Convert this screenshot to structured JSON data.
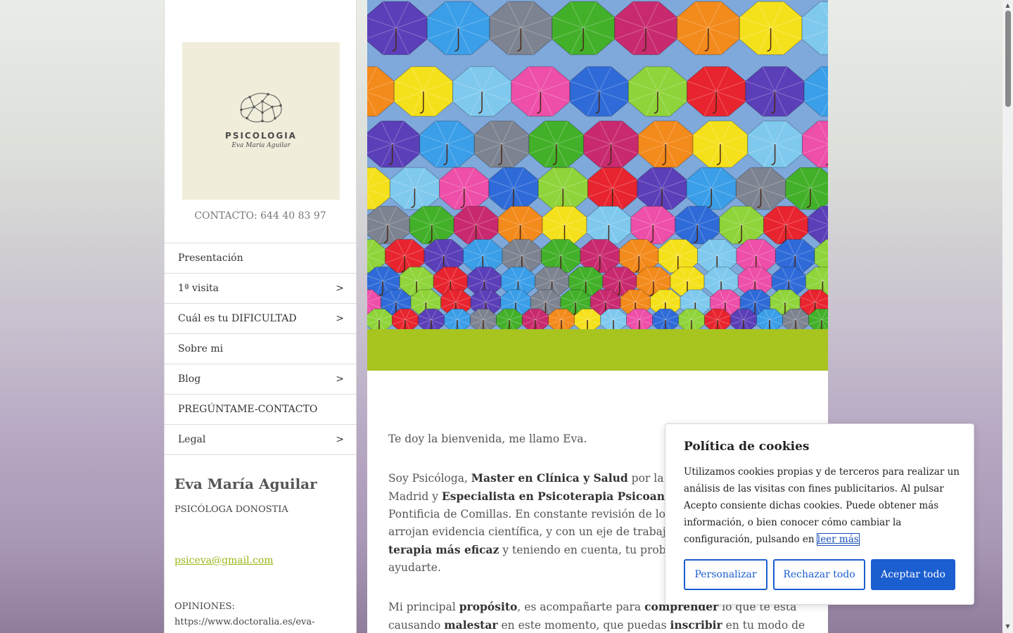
{
  "sidebar": {
    "logo": {
      "word": "PSICOLOGIA",
      "sub": "Eva María Aguilar"
    },
    "contact": "CONTACTO: 644 40 83 97",
    "nav": [
      {
        "label": "Presentación",
        "arrow": ""
      },
      {
        "label": "1ª visita",
        "arrow": ">"
      },
      {
        "label": "Cuál es tu DIFICULTAD",
        "arrow": ">"
      },
      {
        "label": "Sobre mi",
        "arrow": ""
      },
      {
        "label": "Blog",
        "arrow": ">"
      },
      {
        "label": "PREGÚNTAME-CONTACTO",
        "arrow": ""
      },
      {
        "label": "Legal",
        "arrow": ">"
      }
    ],
    "name": "Eva María Aguilar",
    "role": "PSICÓLOGA DONOSTIA",
    "email": "psiceva@gmail.com",
    "opinions_label": "OPINIONES:",
    "opinions_url": "https://www.doctoralia.es/eva-"
  },
  "main": {
    "welcome": "Te doy la bienvenida, me llamo Eva.",
    "p2": {
      "a": "Soy Psicóloga, ",
      "b": "Master en Clínica y Salud",
      "c": " por la Univ",
      "d": "Madrid y ",
      "e": "Especialista en Psicoterapia Psicoanalítica",
      "f": "Pontificia de Comillas. En constante revisión de los ú",
      "g": "arrojan evidencia científica, y con un eje de trabajo s",
      "h": "terapia más eficaz",
      "i": " y teniendo en cuenta, tu problema",
      "j": "ayudarte."
    },
    "p3": {
      "a": "Mi principal ",
      "b": "propósito",
      "c": ", es acompañarte para ",
      "d": "comprender",
      "e": " lo que te está",
      "f": "causando ",
      "g": "malestar",
      "h": " en este momento, que puedas ",
      "i": "inscribir",
      "j": " en tu modo de"
    }
  },
  "cookie": {
    "title": "Política de cookies",
    "text": "Utilizamos cookies propias y de terceros para realizar un análisis de las visitas con fines publicitarios. Al pulsar Acepto consiente dichas cookies. Puede obtener más información, o bien conocer cómo cambiar la configuración, pulsando en ",
    "link": "leer más",
    "buttons": {
      "customize": "Personalizar",
      "reject": "Rechazar todo",
      "accept": "Aceptar todo"
    }
  },
  "colors": {
    "accent_green": "#a8c41f",
    "button_blue": "#1b5ecf",
    "logo_bg": "#f0eedb"
  }
}
